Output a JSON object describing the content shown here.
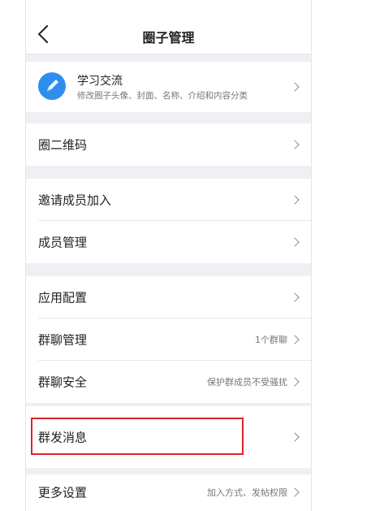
{
  "header": {
    "title": "圈子管理"
  },
  "circle": {
    "name": "学习交流",
    "description": "修改圈子头像、封面、名称、介绍和内容分类"
  },
  "rows": [
    {
      "label": "圈二维码",
      "value": ""
    },
    {
      "label": "邀请成员加入",
      "value": ""
    },
    {
      "label": "成员管理",
      "value": ""
    },
    {
      "label": "应用配置",
      "value": ""
    },
    {
      "label": "群聊管理",
      "value": "1个群聊"
    },
    {
      "label": "群聊安全",
      "value": "保护群成员不受骚扰"
    },
    {
      "label": "群发消息",
      "value": ""
    },
    {
      "label": "更多设置",
      "value": "加入方式、发帖权限"
    }
  ],
  "colors": {
    "accent": "#2e8ef0",
    "highlight": "#e0232b",
    "background": "#efeff4"
  },
  "icons": [
    "back-arrow-icon",
    "pencil-icon",
    "chevron-right-icon"
  ]
}
